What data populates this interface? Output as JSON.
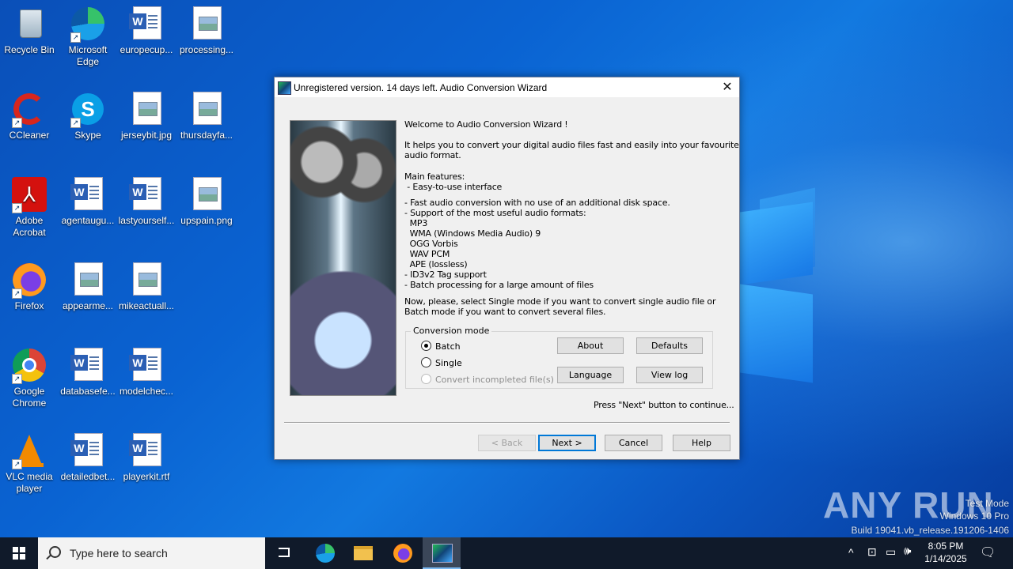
{
  "desktop": {
    "icons": [
      {
        "label": "Recycle Bin",
        "kind": "recycle"
      },
      {
        "label": "Microsoft Edge",
        "kind": "edge"
      },
      {
        "label": "europecup...",
        "kind": "word"
      },
      {
        "label": "processing...",
        "kind": "image"
      },
      {
        "label": "CCleaner",
        "kind": "ccleaner"
      },
      {
        "label": "Skype",
        "kind": "skype"
      },
      {
        "label": "jerseybit.jpg",
        "kind": "image"
      },
      {
        "label": "thursdayfa...",
        "kind": "image"
      },
      {
        "label": "Adobe Acrobat",
        "kind": "acrobat"
      },
      {
        "label": "agentaugu...",
        "kind": "word"
      },
      {
        "label": "lastyourself...",
        "kind": "word"
      },
      {
        "label": "upspain.png",
        "kind": "image"
      },
      {
        "label": "Firefox",
        "kind": "firefox"
      },
      {
        "label": "appearme...",
        "kind": "image"
      },
      {
        "label": "mikeactuall...",
        "kind": "image"
      },
      {
        "label": "Google Chrome",
        "kind": "chrome"
      },
      {
        "label": "databasefe...",
        "kind": "word"
      },
      {
        "label": "modelchec...",
        "kind": "word"
      },
      {
        "label": "VLC media player",
        "kind": "vlc"
      },
      {
        "label": "detailedbet...",
        "kind": "word"
      },
      {
        "label": "playerkit.rtf",
        "kind": "word"
      }
    ]
  },
  "dialog": {
    "title": "Unregistered version. 14 days left. Audio Conversion Wizard",
    "welcome": "Welcome to Audio Conversion Wizard !",
    "intro": "It helps you to convert your digital audio files fast and easily into your favourite\naudio format.",
    "features": "Main features:\n - Easy-to-use interface",
    "details": "- Fast audio conversion with no use of an additional disk space.\n- Support of the most useful audio formats:\n  MP3\n  WMA (Windows Media Audio) 9\n  OGG Vorbis\n  WAV PCM\n  APE (lossless)\n- ID3v2 Tag support\n- Batch processing for a large amount of files",
    "instruction": "Now, please, select Single mode if you want to convert single audio file or\nBatch mode if you want to convert several files.",
    "conversion_mode": {
      "legend": "Conversion mode",
      "batch": "Batch",
      "single": "Single",
      "incompleted": "Convert incompleted file(s)",
      "selected": "Batch"
    },
    "buttons": {
      "about": "About",
      "defaults": "Defaults",
      "language": "Language",
      "view_log": "View log",
      "back": "< Back",
      "next": "Next >",
      "cancel": "Cancel",
      "help": "Help"
    },
    "press_next": "Press \"Next\" button to continue..."
  },
  "watermark": {
    "brand": "ANY RUN",
    "line1": "Test Mode",
    "line2": "Windows 10 Pro",
    "line3": "Build 19041.vb_release.191206-1406"
  },
  "taskbar": {
    "search_placeholder": "Type here to search",
    "time": "8:05 PM",
    "date": "1/14/2025",
    "pinned": [
      "task-view",
      "edge",
      "file-explorer",
      "firefox",
      "audio-conversion-wizard"
    ]
  },
  "colors": {
    "accent": "#0078d7",
    "taskbar": "#101a2a",
    "dialog_bg": "#f0f0f0"
  }
}
